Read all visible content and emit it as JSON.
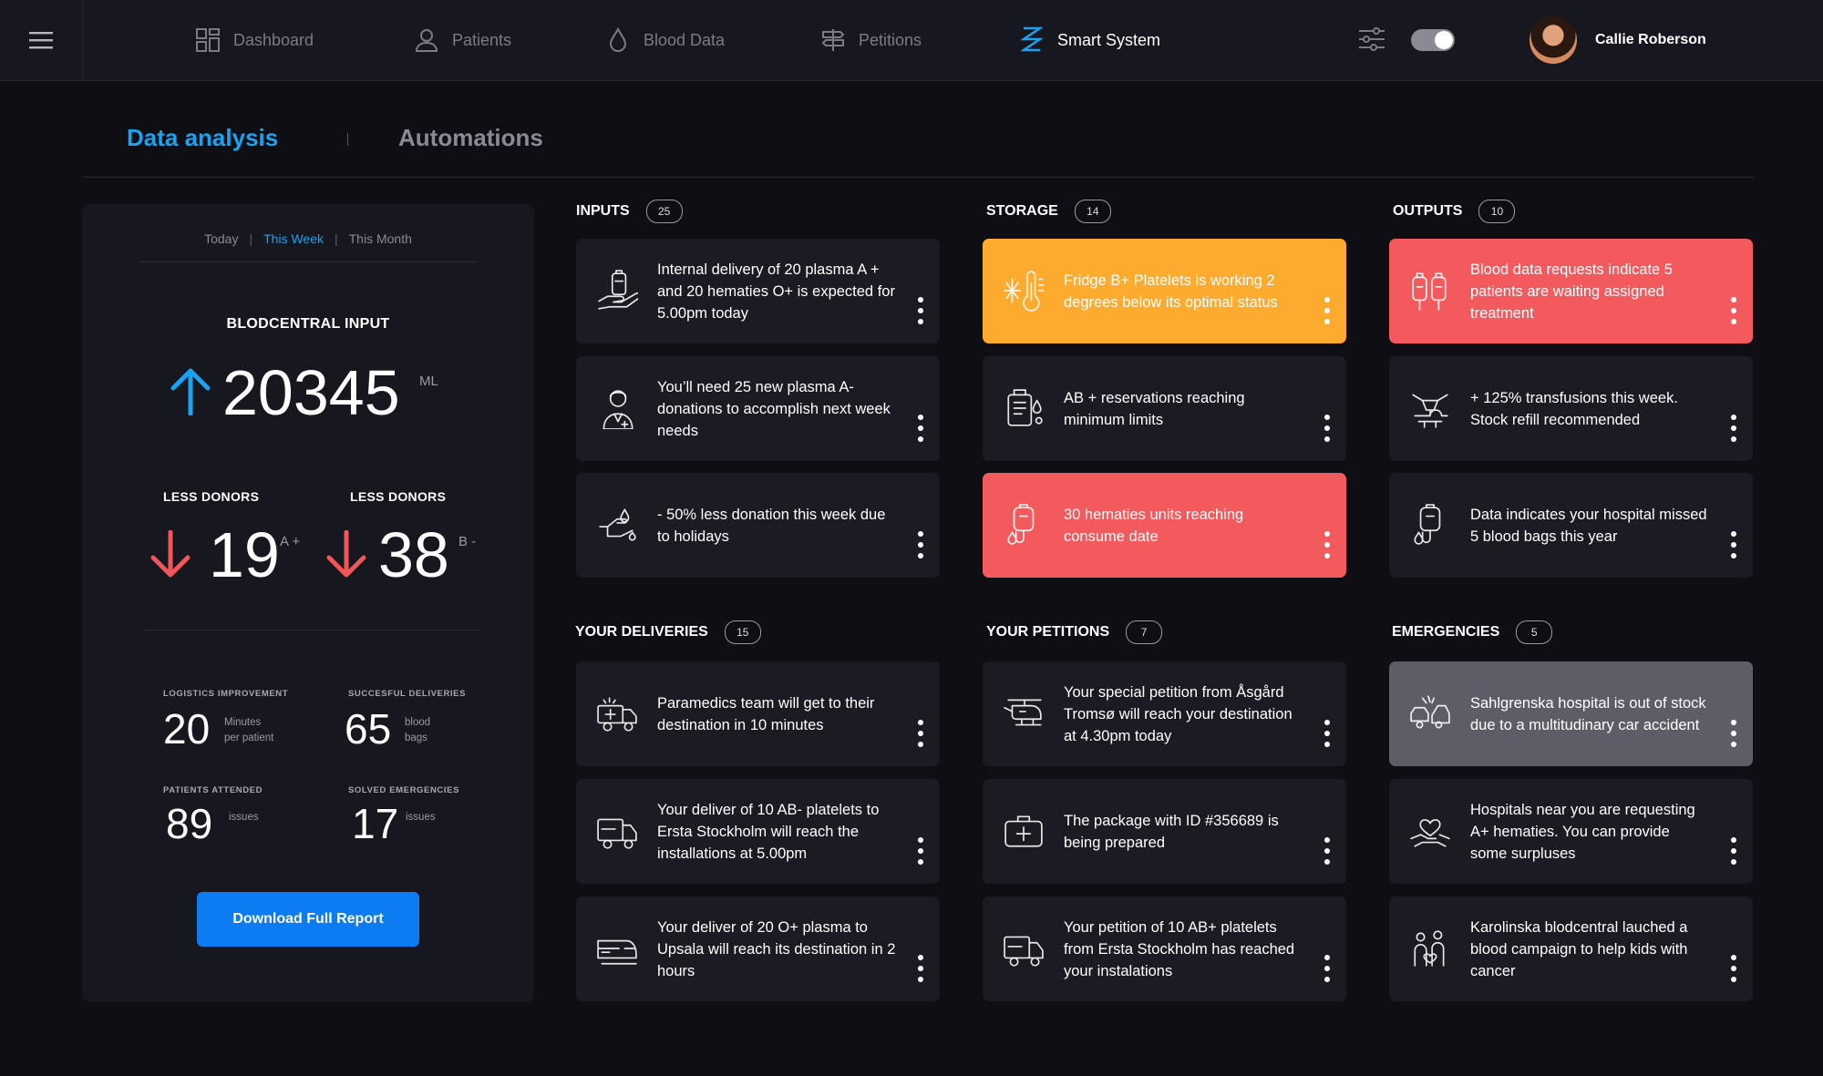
{
  "nav": {
    "items": [
      {
        "label": "Dashboard",
        "icon": "dashboard-icon"
      },
      {
        "label": "Patients",
        "icon": "user-icon"
      },
      {
        "label": "Blood Data",
        "icon": "drop-icon"
      },
      {
        "label": "Petitions",
        "icon": "signpost-icon"
      },
      {
        "label": "Smart System",
        "icon": "dna-icon"
      }
    ],
    "user_name": "Callie Roberson"
  },
  "tabs": {
    "data_analysis": "Data analysis",
    "automations": "Automations"
  },
  "panel": {
    "periods": {
      "today": "Today",
      "week": "This Week",
      "month": "This Month",
      "separator": "|"
    },
    "input_title": "BLODCENTRAL INPUT",
    "input_value": "20345",
    "input_unit": "ML",
    "donors": [
      {
        "label": "LESS DONORS",
        "value": "19",
        "type": "A +"
      },
      {
        "label": "LESS DONORS",
        "value": "38",
        "type": "B -"
      }
    ],
    "metrics": [
      {
        "label": "LOGISTICS IMPROVEMENT",
        "value": "20",
        "unit1": "Minutes",
        "unit2": "per patient"
      },
      {
        "label": "SUCCESFUL DELIVERIES",
        "value": "65",
        "unit1": "blood",
        "unit2": "bags"
      },
      {
        "label": "PATIENTS ATTENDED",
        "value": "89",
        "unit1": "issues",
        "unit2": ""
      },
      {
        "label": "SOLVED  EMERGENCIES",
        "value": "17",
        "unit1": "issues",
        "unit2": ""
      }
    ],
    "download_label": "Download Full Report"
  },
  "colors": {
    "accent": "#0d7bf2",
    "warning": "#fdab2f",
    "danger": "#f25a5e",
    "muted": "#5d5d68",
    "up_arrow": "#1aa3f0",
    "down_arrow": "#f0565a"
  },
  "sections": [
    {
      "title": "INPUTS",
      "count": "25",
      "cards": [
        {
          "text": "Internal delivery of 20 plasma A + and 20 hematies O+ is expected for 5.00pm today",
          "icon": "blood-bag-hand-icon",
          "state": "default"
        },
        {
          "text": "You’ll need 25 new plasma A- donations to accomplish next week needs",
          "icon": "doctor-icon",
          "state": "default"
        },
        {
          "text": "- 50% less donation this week due to holidays",
          "icon": "hand-drop-icon",
          "state": "default"
        }
      ]
    },
    {
      "title": "STORAGE",
      "count": "14",
      "cards": [
        {
          "text": "Fridge B+ Platelets is working 2 degrees below its optimal status",
          "icon": "thermometer-snow-icon",
          "state": "orange"
        },
        {
          "text": "AB + reservations reaching minimum limits",
          "icon": "blood-storage-icon",
          "state": "default"
        },
        {
          "text": "30 hematies units reaching consume date",
          "icon": "iv-bag-icon",
          "state": "red"
        }
      ]
    },
    {
      "title": "OUTPUTS",
      "count": "10",
      "cards": [
        {
          "text": "Blood data requests indicate 5 patients are waiting assigned treatment",
          "icon": "blood-bags-icon",
          "state": "red"
        },
        {
          "text": "+ 125% transfusions this week. Stock refill recommended",
          "icon": "transfusion-icon",
          "state": "default"
        },
        {
          "text": "Data indicates your hospital missed 5 blood bags this year",
          "icon": "iv-bag-icon",
          "state": "default"
        }
      ]
    },
    {
      "title": "YOUR DELIVERIES",
      "count": "15",
      "cards": [
        {
          "text": "Paramedics team will get to their destination in 10 minutes",
          "icon": "ambulance-icon",
          "state": "default"
        },
        {
          "text": "Your deliver of 10 AB- platelets to Ersta Stockholm will reach the installations at 5.00pm",
          "icon": "truck-icon",
          "state": "default"
        },
        {
          "text": "Your deliver of 20 O+ plasma to Upsala will reach its destination in 2 hours",
          "icon": "train-icon",
          "state": "default"
        }
      ]
    },
    {
      "title": "YOUR PETITIONS",
      "count": "7",
      "cards": [
        {
          "text": "Your special petition from Åsgård Tromsø will reach your destination at 4.30pm today",
          "icon": "helicopter-icon",
          "state": "default"
        },
        {
          "text": "The package with ID #356689 is being prepared",
          "icon": "medical-kit-icon",
          "state": "default"
        },
        {
          "text": "Your petition of 10 AB+ platelets from Ersta Stockholm has reached your instalations",
          "icon": "truck-icon",
          "state": "default"
        }
      ]
    },
    {
      "title": "EMERGENCIES",
      "count": "5",
      "cards": [
        {
          "text": "Sahlgrenska hospital is out of stock due to a multitudinary car accident",
          "icon": "car-accident-icon",
          "state": "gray"
        },
        {
          "text": "Hospitals near you are requesting A+ hematies. You can provide some surpluses",
          "icon": "heart-hands-icon",
          "state": "default"
        },
        {
          "text": "Karolinska blodcentral lauched a blood campaign to help kids with cancer",
          "icon": "kids-heart-icon",
          "state": "default"
        }
      ]
    }
  ]
}
